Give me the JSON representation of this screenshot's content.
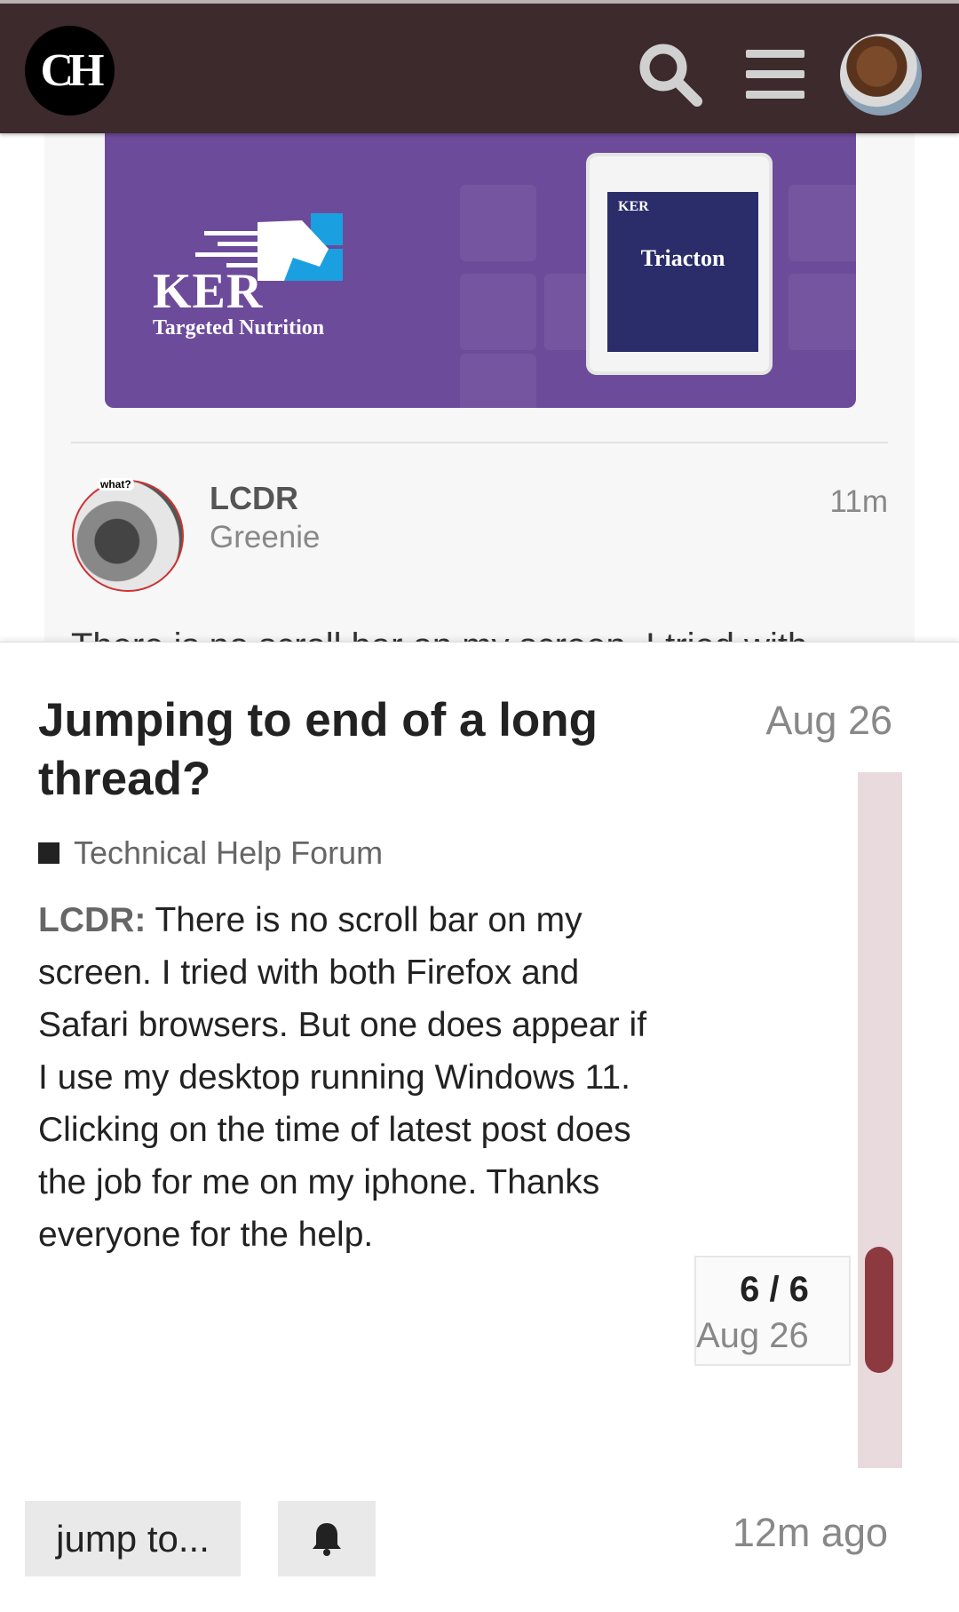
{
  "header": {
    "logo_text": "CH",
    "search_icon": "search-icon",
    "menu_icon": "hamburger-menu-icon",
    "avatar_icon": "user-avatar"
  },
  "ad": {
    "brand": "KER",
    "tagline": "Targeted Nutrition",
    "product": "Triacton",
    "bucket_brand": "KER"
  },
  "post": {
    "avatar_tag": "what?",
    "username": "LCDR",
    "user_title": "Greenie",
    "time": "11m",
    "preview": "There is no scroll bar on my screen. I tried with"
  },
  "topic": {
    "title": "Jumping to end of a long thread?",
    "date": "Aug 26",
    "category": "Technical Help Forum",
    "category_color": "#222222",
    "excerpt_author": "LCDR:",
    "excerpt_text": " There is no scroll bar on my screen. I tried with both Firefox and Safari browsers. But one does appear if I use my desktop running Windows 11. Clicking on the time of latest post does the job for me on my iphone. Thanks everyone for the help."
  },
  "timeline": {
    "count": "6 / 6",
    "date": "Aug 26",
    "position": 1.0
  },
  "footer": {
    "jump_label": "jump to...",
    "bell_icon": "bell-icon",
    "last_activity": "12m ago"
  },
  "colors": {
    "header_bg": "#3d2a2d",
    "timeline_handle": "#8c3a40",
    "ad_bg": "#6d4b9b"
  }
}
